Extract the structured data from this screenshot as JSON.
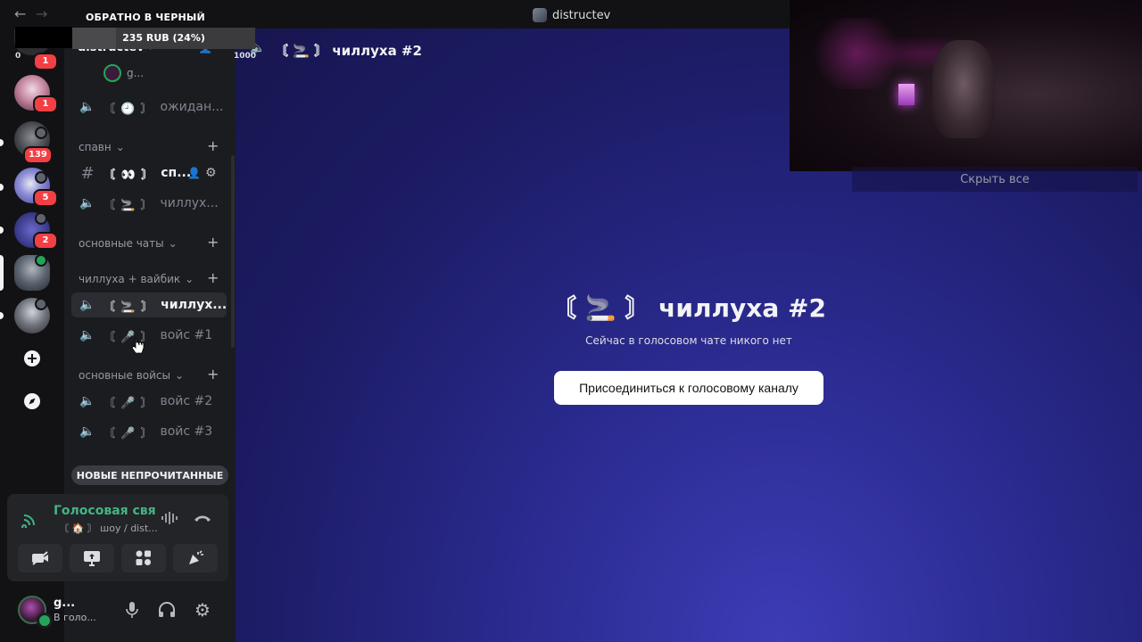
{
  "window": {
    "title": "distructev"
  },
  "donation": {
    "title": "ОБРАТНО В ЧЕРНЫЙ",
    "progress_text": "235 RUB (24%)",
    "progress": 0.24
  },
  "header_counts": {
    "left": "0",
    "right": "1000"
  },
  "rail": {
    "badges": [
      "1",
      "1",
      "139",
      "5",
      "2"
    ]
  },
  "sidebar": {
    "guild_name": "distructev",
    "top_partial": "g...",
    "categories": {
      "spawn": "спавн",
      "main_chats": "основные чаты",
      "chill": "чиллуха + вайбик",
      "main_voices": "основные войсы"
    },
    "channels": {
      "waiting": {
        "emoji": "〘 🕘 〙",
        "name": "ожидан..."
      },
      "sp": {
        "emoji": "〘 👀 〙",
        "name": "сп..."
      },
      "chill1": {
        "emoji": "〘 🚬 〙",
        "name": "чиллух..."
      },
      "chill2": {
        "emoji": "〘 🚬 〙",
        "name": "чиллух..."
      },
      "voice1": {
        "emoji": "〘 🎤 〙",
        "name": "войс #1"
      },
      "voice2": {
        "emoji": "〘 🎤 〙",
        "name": "войс #2"
      },
      "voice3": {
        "emoji": "〘 🎤 〙",
        "name": "войс #3"
      }
    },
    "unread_pill": "НОВЫЕ НЕПРОЧИТАННЫЕ"
  },
  "voice_panel": {
    "status": "Голосовая связь",
    "sub": "〘 🏠 〙 шоу / dist..."
  },
  "user": {
    "name": "g...",
    "status": "В голо..."
  },
  "main": {
    "header_title": "〘 🚬 〙 чиллуха #2",
    "center_title": "〘 🚬 〙 чиллуха #2",
    "center_sub": "Сейчас в голосовом чате никого нет",
    "join_button": "Присоединиться к голосовому каналу"
  },
  "camera": {
    "hide_all": "Скрыть все"
  },
  "colors": {
    "voice_connected": "#43b581",
    "badge": "#f23f43",
    "main_bg": "#2a2a8f"
  }
}
